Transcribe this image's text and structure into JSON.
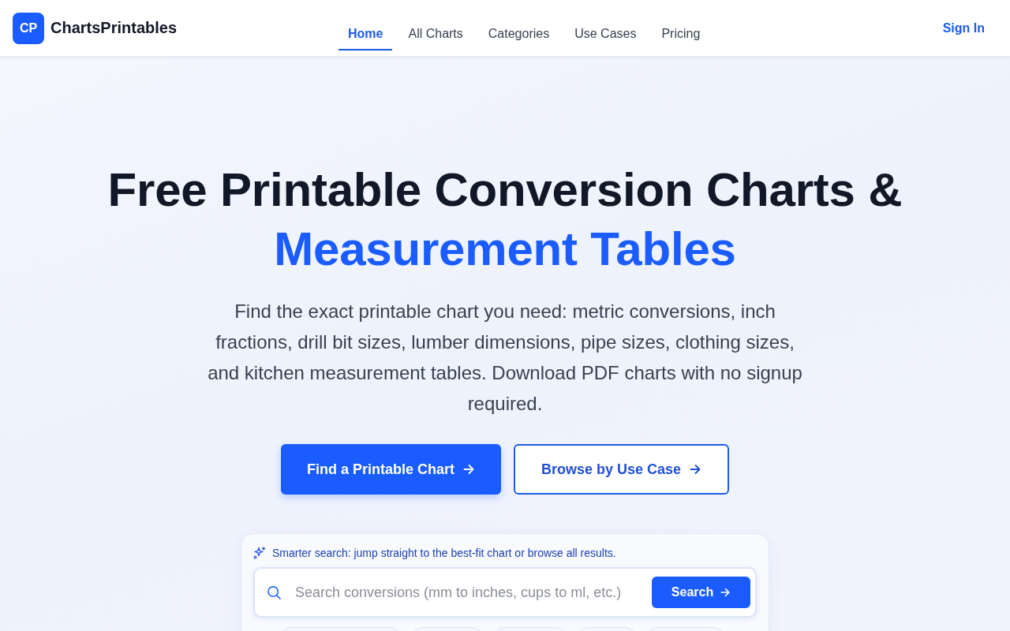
{
  "header": {
    "logo_mark": "CP",
    "brand": "ChartsPrintables",
    "nav": [
      {
        "label": "Home",
        "selected": true
      },
      {
        "label": "All Charts",
        "selected": false
      },
      {
        "label": "Categories",
        "selected": false
      },
      {
        "label": "Use Cases",
        "selected": false
      },
      {
        "label": "Pricing",
        "selected": false
      }
    ],
    "sign_in": "Sign In"
  },
  "hero": {
    "title": "Free Printable Conversion Charts &",
    "title_highlight": "Measurement Tables",
    "description": "Find the exact printable chart you need: metric conversions, inch fractions, drill bit sizes, lumber dimensions, pipe sizes, clothing sizes, and kitchen measurement tables. Download PDF charts with no signup required.",
    "buttons": [
      {
        "label": "Find a Printable Chart",
        "kind": "primary"
      },
      {
        "label": "Browse by Use Case",
        "kind": "secondary"
      }
    ]
  },
  "search": {
    "hint": "Smarter search: jump straight to the best-fit chart or browse all results.",
    "placeholder": "Search conversions (mm to inches, cups to ml, etc.)",
    "button": "Search"
  }
}
